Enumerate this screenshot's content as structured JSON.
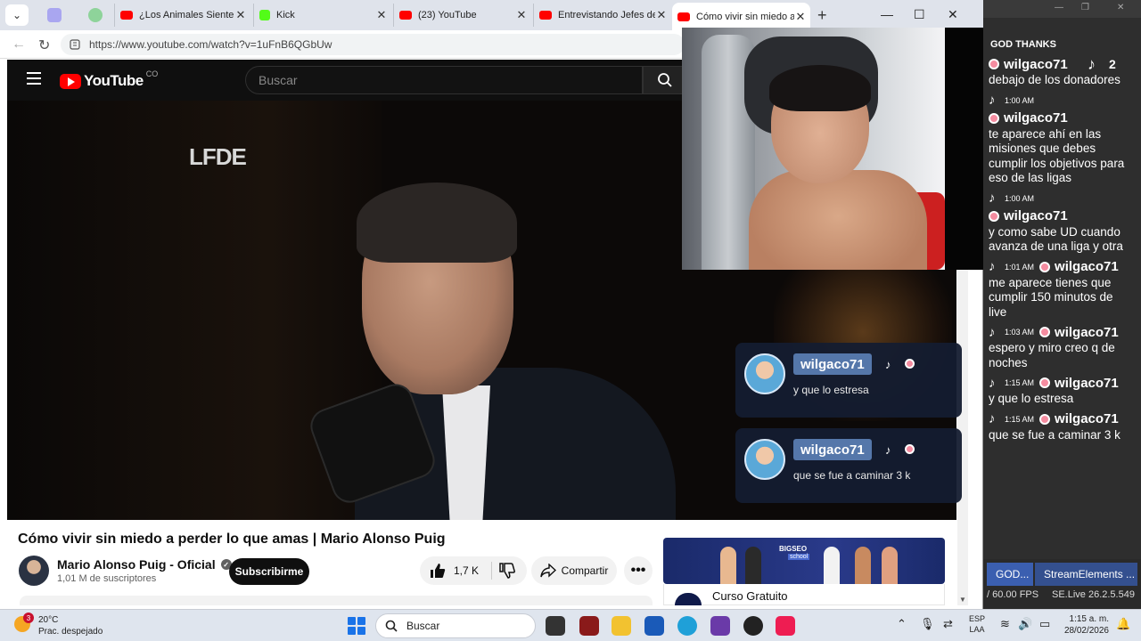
{
  "browser": {
    "tabs": [
      {
        "title": "¿Los Animales Sienten A",
        "favicon_color": "#ff0000"
      },
      {
        "title": "Kick",
        "favicon_color": "#53fc18"
      },
      {
        "title": "(23) YouTube",
        "favicon_color": "#ff0000"
      },
      {
        "title": "Entrevistando Jefes de N",
        "favicon_color": "#ff0000"
      },
      {
        "title": "Cómo vivir sin miedo a p",
        "favicon_color": "#ff0000",
        "active": true
      }
    ],
    "url": "https://www.youtube.com/watch?v=1uFnB6QGbUw"
  },
  "youtube": {
    "logo_text": "YouTube",
    "country_code": "CO",
    "search_placeholder": "Buscar",
    "video_watermark": "LFDE",
    "video_title": "Cómo vivir sin miedo a perder lo que amas | Mario Alonso Puig",
    "channel_name": "Mario Alonso Puig - Oficial",
    "subscribers": "1,01 M de suscriptores",
    "subscribe_label": "Subscribirme",
    "likes": "1,7 K",
    "share_label": "Compartir",
    "ad_brand": "BIGSEO",
    "ad_school": "school",
    "ad_title": "Curso Gratuito"
  },
  "overlay_notifications": [
    {
      "username": "wilgaco71",
      "message": "y que lo estresa"
    },
    {
      "username": "wilgaco71",
      "message": "que se fue a caminar 3 k"
    }
  ],
  "chat": {
    "header": "GOD THANKS",
    "viewer_count": "2",
    "messages": [
      {
        "time": "",
        "user": "wilgaco71",
        "text": "debajo de los donadores"
      },
      {
        "time": "1:00 AM",
        "user": "wilgaco71",
        "text": "te aparece ahí en las misiones que debes cumplir los objetivos para eso de las ligas"
      },
      {
        "time": "1:00 AM",
        "user": "wilgaco71",
        "text": "y como sabe UD cuando avanza de una liga y otra"
      },
      {
        "time": "1:01 AM",
        "user": "wilgaco71",
        "text": "me aparece tienes que cumplir 150 minutos de live"
      },
      {
        "time": "1:03 AM",
        "user": "wilgaco71",
        "text": "espero y miro creo q de noches"
      },
      {
        "time": "1:15 AM",
        "user": "wilgaco71",
        "text": "y que lo estresa"
      },
      {
        "time": "1:15 AM",
        "user": "wilgaco71",
        "text": "que se fue a caminar 3 k"
      }
    ],
    "tab1": "GOD...",
    "tab2": "StreamElements ...",
    "fps": "/ 60.00 FPS",
    "version": "SE.Live 26.2.5.549"
  },
  "taskbar": {
    "weather_temp": "20°C",
    "weather_cond": "Prac. despejado",
    "weather_badge": "3",
    "search_label": "Buscar",
    "lang_top": "ESP",
    "lang_bottom": "LAA",
    "time": "1:15 a. m.",
    "date": "28/02/2026"
  }
}
